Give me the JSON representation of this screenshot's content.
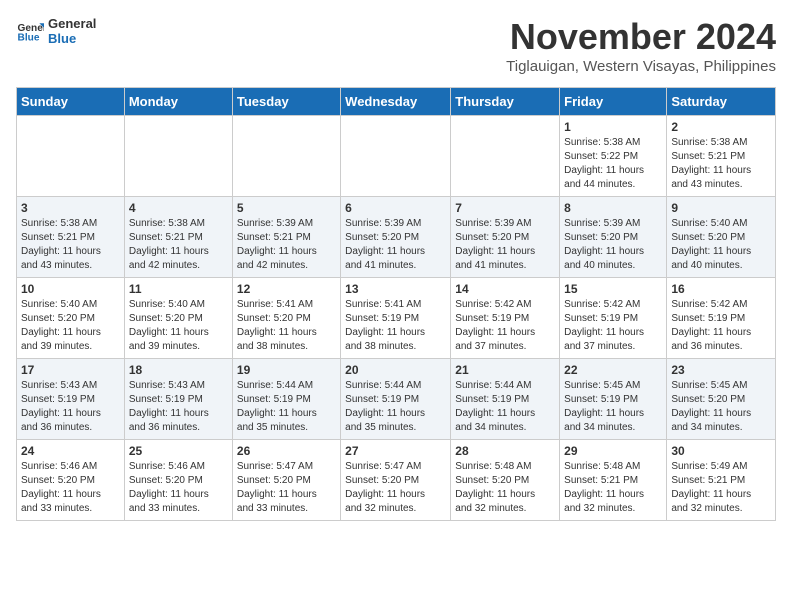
{
  "header": {
    "logo_line1": "General",
    "logo_line2": "Blue",
    "month_title": "November 2024",
    "subtitle": "Tiglauigan, Western Visayas, Philippines"
  },
  "weekdays": [
    "Sunday",
    "Monday",
    "Tuesday",
    "Wednesday",
    "Thursday",
    "Friday",
    "Saturday"
  ],
  "weeks": [
    [
      {
        "day": "",
        "info": ""
      },
      {
        "day": "",
        "info": ""
      },
      {
        "day": "",
        "info": ""
      },
      {
        "day": "",
        "info": ""
      },
      {
        "day": "",
        "info": ""
      },
      {
        "day": "1",
        "info": "Sunrise: 5:38 AM\nSunset: 5:22 PM\nDaylight: 11 hours\nand 44 minutes."
      },
      {
        "day": "2",
        "info": "Sunrise: 5:38 AM\nSunset: 5:21 PM\nDaylight: 11 hours\nand 43 minutes."
      }
    ],
    [
      {
        "day": "3",
        "info": "Sunrise: 5:38 AM\nSunset: 5:21 PM\nDaylight: 11 hours\nand 43 minutes."
      },
      {
        "day": "4",
        "info": "Sunrise: 5:38 AM\nSunset: 5:21 PM\nDaylight: 11 hours\nand 42 minutes."
      },
      {
        "day": "5",
        "info": "Sunrise: 5:39 AM\nSunset: 5:21 PM\nDaylight: 11 hours\nand 42 minutes."
      },
      {
        "day": "6",
        "info": "Sunrise: 5:39 AM\nSunset: 5:20 PM\nDaylight: 11 hours\nand 41 minutes."
      },
      {
        "day": "7",
        "info": "Sunrise: 5:39 AM\nSunset: 5:20 PM\nDaylight: 11 hours\nand 41 minutes."
      },
      {
        "day": "8",
        "info": "Sunrise: 5:39 AM\nSunset: 5:20 PM\nDaylight: 11 hours\nand 40 minutes."
      },
      {
        "day": "9",
        "info": "Sunrise: 5:40 AM\nSunset: 5:20 PM\nDaylight: 11 hours\nand 40 minutes."
      }
    ],
    [
      {
        "day": "10",
        "info": "Sunrise: 5:40 AM\nSunset: 5:20 PM\nDaylight: 11 hours\nand 39 minutes."
      },
      {
        "day": "11",
        "info": "Sunrise: 5:40 AM\nSunset: 5:20 PM\nDaylight: 11 hours\nand 39 minutes."
      },
      {
        "day": "12",
        "info": "Sunrise: 5:41 AM\nSunset: 5:20 PM\nDaylight: 11 hours\nand 38 minutes."
      },
      {
        "day": "13",
        "info": "Sunrise: 5:41 AM\nSunset: 5:19 PM\nDaylight: 11 hours\nand 38 minutes."
      },
      {
        "day": "14",
        "info": "Sunrise: 5:42 AM\nSunset: 5:19 PM\nDaylight: 11 hours\nand 37 minutes."
      },
      {
        "day": "15",
        "info": "Sunrise: 5:42 AM\nSunset: 5:19 PM\nDaylight: 11 hours\nand 37 minutes."
      },
      {
        "day": "16",
        "info": "Sunrise: 5:42 AM\nSunset: 5:19 PM\nDaylight: 11 hours\nand 36 minutes."
      }
    ],
    [
      {
        "day": "17",
        "info": "Sunrise: 5:43 AM\nSunset: 5:19 PM\nDaylight: 11 hours\nand 36 minutes."
      },
      {
        "day": "18",
        "info": "Sunrise: 5:43 AM\nSunset: 5:19 PM\nDaylight: 11 hours\nand 36 minutes."
      },
      {
        "day": "19",
        "info": "Sunrise: 5:44 AM\nSunset: 5:19 PM\nDaylight: 11 hours\nand 35 minutes."
      },
      {
        "day": "20",
        "info": "Sunrise: 5:44 AM\nSunset: 5:19 PM\nDaylight: 11 hours\nand 35 minutes."
      },
      {
        "day": "21",
        "info": "Sunrise: 5:44 AM\nSunset: 5:19 PM\nDaylight: 11 hours\nand 34 minutes."
      },
      {
        "day": "22",
        "info": "Sunrise: 5:45 AM\nSunset: 5:19 PM\nDaylight: 11 hours\nand 34 minutes."
      },
      {
        "day": "23",
        "info": "Sunrise: 5:45 AM\nSunset: 5:20 PM\nDaylight: 11 hours\nand 34 minutes."
      }
    ],
    [
      {
        "day": "24",
        "info": "Sunrise: 5:46 AM\nSunset: 5:20 PM\nDaylight: 11 hours\nand 33 minutes."
      },
      {
        "day": "25",
        "info": "Sunrise: 5:46 AM\nSunset: 5:20 PM\nDaylight: 11 hours\nand 33 minutes."
      },
      {
        "day": "26",
        "info": "Sunrise: 5:47 AM\nSunset: 5:20 PM\nDaylight: 11 hours\nand 33 minutes."
      },
      {
        "day": "27",
        "info": "Sunrise: 5:47 AM\nSunset: 5:20 PM\nDaylight: 11 hours\nand 32 minutes."
      },
      {
        "day": "28",
        "info": "Sunrise: 5:48 AM\nSunset: 5:20 PM\nDaylight: 11 hours\nand 32 minutes."
      },
      {
        "day": "29",
        "info": "Sunrise: 5:48 AM\nSunset: 5:21 PM\nDaylight: 11 hours\nand 32 minutes."
      },
      {
        "day": "30",
        "info": "Sunrise: 5:49 AM\nSunset: 5:21 PM\nDaylight: 11 hours\nand 32 minutes."
      }
    ]
  ]
}
